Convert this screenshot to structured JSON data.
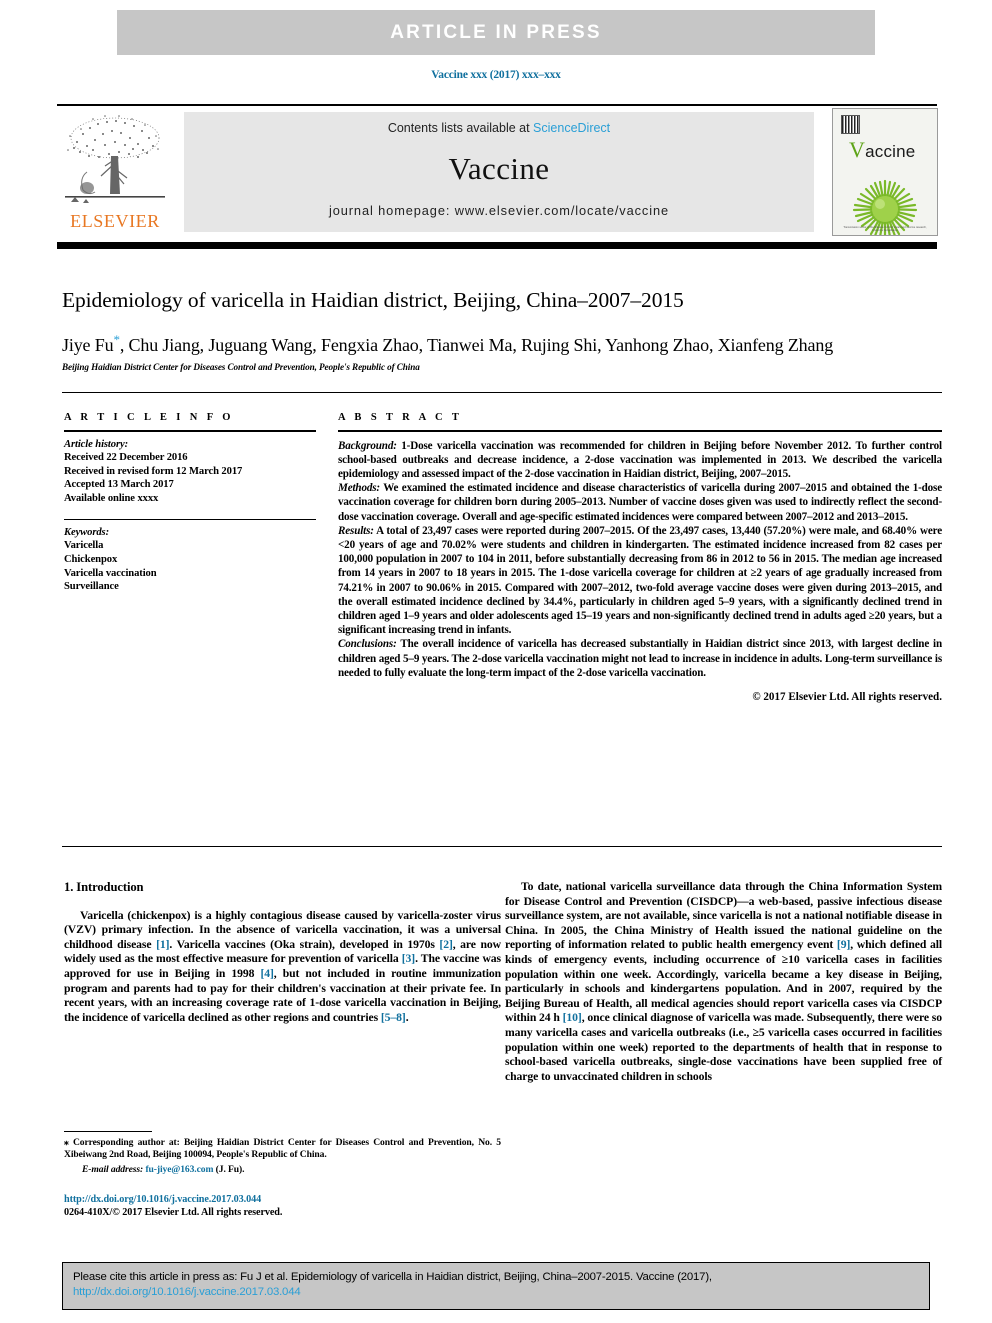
{
  "banner": {
    "text": "ARTICLE  IN  PRESS"
  },
  "running_head": "Vaccine xxx (2017) xxx–xxx",
  "masthead": {
    "contents_prefix": "Contents lists available at ",
    "sciencedirect": "ScienceDirect",
    "journal_name": "Vaccine",
    "homepage": "journal homepage: www.elsevier.com/locate/vaccine",
    "publisher": "ELSEVIER",
    "cover_title": "accine",
    "cover_title_initial": "V",
    "cover_caption": "Transmission vector of the Disease Control: Asian and vaccine research, Control & Surveillance"
  },
  "article": {
    "title": "Epidemiology of varicella in Haidian district, Beijing, China–2007–2015",
    "authors": "Jiye Fu",
    "authors_rest": ", Chu Jiang, Juguang Wang, Fengxia Zhao, Tianwei Ma, Rujing Shi, Yanhong Zhao, Xianfeng Zhang",
    "corresponding_marker": "*",
    "affiliation": "Beijing Haidian District Center for Diseases Control and Prevention, People's Republic of China"
  },
  "info": {
    "heading": "A R T I C L E   I N F O",
    "history_label": "Article history:",
    "history": [
      "Received 22 December 2016",
      "Received in revised form 12 March 2017",
      "Accepted 13 March 2017",
      "Available online xxxx"
    ],
    "keywords_label": "Keywords:",
    "keywords": [
      "Varicella",
      "Chickenpox",
      "Varicella vaccination",
      "Surveillance"
    ]
  },
  "abstract": {
    "heading": "A B S T R A C T",
    "background_label": "Background:",
    "background": " 1-Dose varicella vaccination was recommended for children in Beijing before November 2012. To further control school-based outbreaks and decrease incidence, a 2-dose vaccination was implemented in 2013. We described the varicella epidemiology and assessed impact of the 2-dose vaccination in Haidian district, Beijing, 2007–2015.",
    "methods_label": "Methods:",
    "methods": " We examined the estimated incidence and disease characteristics of varicella during 2007–2015 and obtained the 1-dose vaccination coverage for children born during 2005–2013. Number of vaccine doses given was used to indirectly reflect the second-dose vaccination coverage. Overall and age-specific estimated incidences were compared between 2007–2012 and 2013–2015.",
    "results_label": "Results:",
    "results": " A total of 23,497 cases were reported during 2007–2015. Of the 23,497 cases, 13,440 (57.20%) were male, and 68.40% were <20 years of age and 70.02% were students and children in kindergarten. The estimated incidence increased from 82 cases per 100,000 population in 2007 to 104 in 2011, before substantially decreasing from 86 in 2012 to 56 in 2015. The median age increased from 14 years in 2007 to 18 years in 2015. The 1-dose varicella coverage for children at ≥2 years of age gradually increased from 74.21% in 2007 to 90.06% in 2015. Compared with 2007–2012, two-fold average vaccine doses were given during 2013–2015, and the overall estimated incidence declined by 34.4%, particularly in children aged 5–9 years, with a significantly declined trend in children aged 1–9 years and older adolescents aged 15–19 years and non-significantly declined trend in adults aged ≥20 years, but a significant increasing trend in infants.",
    "conclusions_label": "Conclusions:",
    "conclusions": " The overall incidence of varicella has decreased substantially in Haidian district since 2013, with largest decline in children aged 5–9 years. The 2-dose varicella vaccination might not lead to increase in incidence in adults. Long-term surveillance is needed to fully evaluate the long-term impact of the 2-dose varicella vaccination.",
    "copyright": "© 2017 Elsevier Ltd. All rights reserved."
  },
  "introduction": {
    "heading": "1. Introduction",
    "left_p1_a": "Varicella (chickenpox) is a highly contagious disease caused by varicella-zoster virus (VZV) primary infection. In the absence of varicella vaccination, it was a universal childhood disease ",
    "ref1": "[1]",
    "left_p1_b": ". Varicella vaccines (Oka strain), developed in 1970s ",
    "ref2": "[2]",
    "left_p1_c": ", are now widely used as the most effective measure for prevention of varicella ",
    "ref3": "[3]",
    "left_p1_d": ". The vaccine was approved for use in Beijing in 1998 ",
    "ref4": "[4]",
    "left_p1_e": ", but not included in routine immunization program and parents had to pay for their children's vaccination at their private fee. In recent years, with an increasing coverage rate of 1-dose varicella vaccination in Beijing, the incidence of varicella declined as other regions and countries ",
    "ref58": "[5–8]",
    "left_p1_f": ".",
    "right_p1_a": "To date, national varicella surveillance data through the China Information System for Disease Control and Prevention (CISDCP)—a web-based, passive infectious disease surveillance system, are not available, since varicella is not a national notifiable disease in China. In 2005, the China Ministry of Health issued the national guideline on the reporting of information related to public health emergency event ",
    "ref9": "[9]",
    "right_p1_b": ", which defined all kinds of emergency events, including occurrence of ≥10 varicella cases in facilities population within one week. Accordingly, varicella became a key disease in Beijing, particularly in schools and kindergartens population. And in 2007, required by the Beijing Bureau of Health, all medical agencies should report varicella cases via CISDCP within 24 h ",
    "ref10": "[10]",
    "right_p1_c": ", once clinical diagnose of varicella was made. Subsequently, there were so many varicella cases and varicella outbreaks (i.e., ≥5 varicella cases occurred in facilities population within one week) reported to the departments of health that in response to school-based varicella outbreaks, single-dose vaccinations have been supplied free of charge to unvaccinated children in schools"
  },
  "footnote": {
    "marker": "⁎",
    "corresponding": " Corresponding author at: Beijing Haidian District Center for Diseases Control and Prevention, No. 5 Xibeiwang 2nd Road, Beijing 100094, People's Republic of China.",
    "email_label": "E-mail address:",
    "email": "fu-jiye@163.com",
    "email_suffix": " (J. Fu)."
  },
  "doi": {
    "url": "http://dx.doi.org/10.1016/j.vaccine.2017.03.044",
    "issn_line": "0264-410X/© 2017 Elsevier Ltd. All rights reserved."
  },
  "cite": {
    "text": "Please cite this article in press as: Fu J et al. Epidemiology of varicella in Haidian district, Beijing, China–2007-2015. Vaccine (2017), ",
    "link1": "http://dx.doi.org/",
    "link2": "10.1016/j.vaccine.2017.03.044"
  },
  "colors": {
    "banner_bg": "#c6c6c6",
    "masthead_bg": "#e6e6e6",
    "link_blue": "#10709e",
    "sciencedirect_blue": "#2a9fd6",
    "elsevier_orange": "#e87722",
    "cover_green": "#5ea418"
  }
}
